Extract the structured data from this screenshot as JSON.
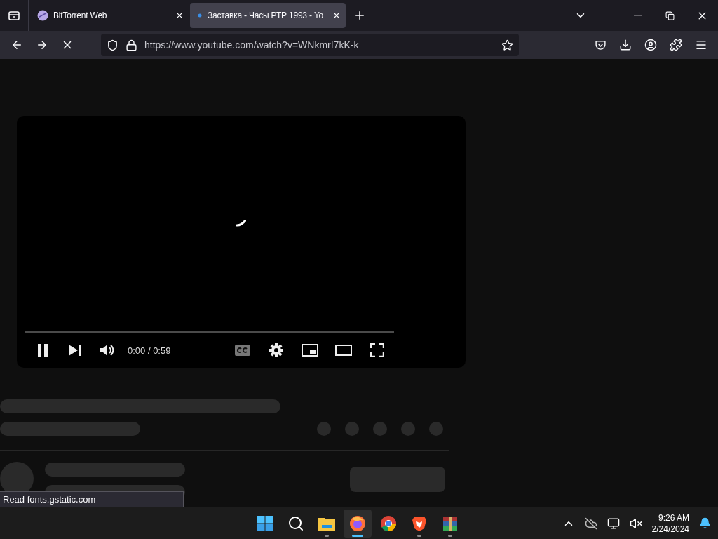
{
  "tabs": [
    {
      "title": "BitTorrent Web",
      "selected": false,
      "kind": "bittorrent"
    },
    {
      "title": "Заставка - Часы РТР 1993 - Yo",
      "selected": true,
      "kind": "youtube"
    }
  ],
  "address_bar": {
    "url": "https://www.youtube.com/watch?v=WNkmrI7kK-k"
  },
  "page_loading": true,
  "video": {
    "time": "0:00 / 0:59",
    "playing": true,
    "progress": {
      "level": 0
    },
    "captions_available": true
  },
  "status_text": "Read fonts.gstatic.com",
  "taskbar": {
    "apps": [
      {
        "kind": "start",
        "running": false,
        "selected": false
      },
      {
        "kind": "search",
        "running": false,
        "selected": false
      },
      {
        "kind": "files",
        "running": true,
        "selected": false
      },
      {
        "kind": "firefox",
        "running": true,
        "selected": true
      },
      {
        "kind": "chrome",
        "running": false,
        "selected": false
      },
      {
        "kind": "brave",
        "running": true,
        "selected": false
      },
      {
        "kind": "winrar",
        "running": true,
        "selected": false
      }
    ],
    "clock": {
      "time": "9:26 AM",
      "date": "2/24/2024"
    }
  }
}
